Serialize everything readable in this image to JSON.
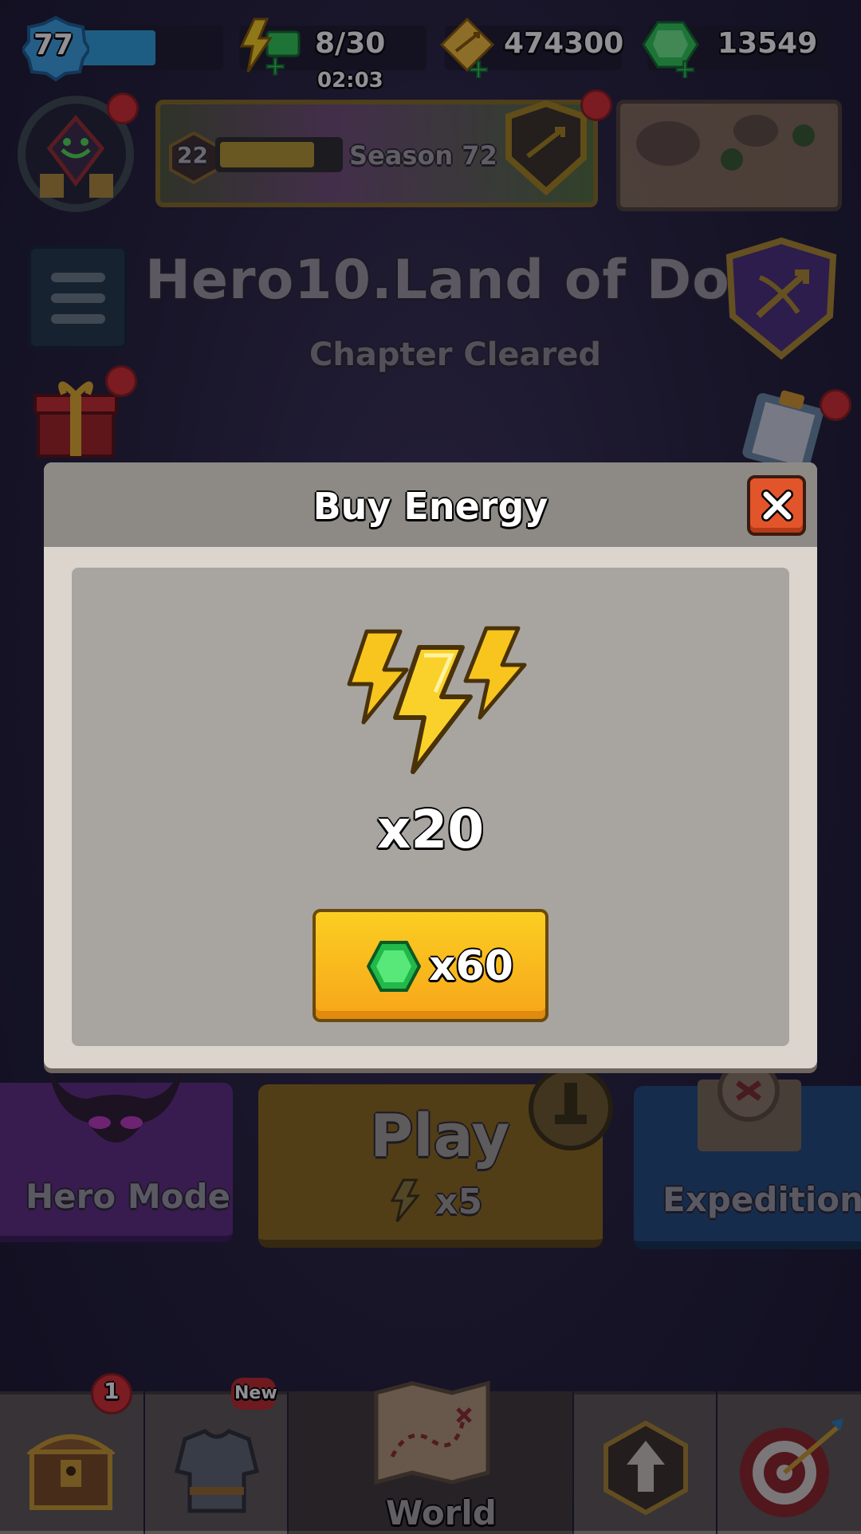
{
  "top_bar": {
    "level": "77",
    "energy": "8/30",
    "energy_timer": "02:03",
    "gold": "474300",
    "gems": "13549"
  },
  "season": {
    "level": "22",
    "label": "Season 72"
  },
  "chapter": {
    "title": "Hero10.Land of Doom",
    "status": "Chapter Cleared"
  },
  "dialog": {
    "title": "Buy Energy",
    "amount": "x20",
    "price": "x60"
  },
  "modes": {
    "hero_mode": "Hero Mode",
    "play": "Play",
    "play_cost": "x5",
    "expedition": "Expedition"
  },
  "bottom_nav": {
    "chest_badge": "1",
    "armor_badge": "New",
    "world": "World"
  },
  "icons": [
    "level-badge-icon",
    "energy-bolt-icon",
    "gold-arrow-icon",
    "gem-icon",
    "avatar-icon",
    "season-badge-icon",
    "map-icon",
    "menu-icon",
    "bow-badge-icon",
    "gift-icon",
    "clipboard-icon",
    "close-icon",
    "lightning-icon",
    "demon-icon",
    "trophy-icon",
    "expedition-map-icon",
    "chest-icon",
    "armor-icon",
    "world-map-icon",
    "upgrade-icon",
    "target-icon"
  ],
  "colors": {
    "accent_gold": "#f6b81c",
    "gem_green": "#2ecc52",
    "energy_blue": "#2ea3df",
    "close_red": "#e2542a"
  }
}
